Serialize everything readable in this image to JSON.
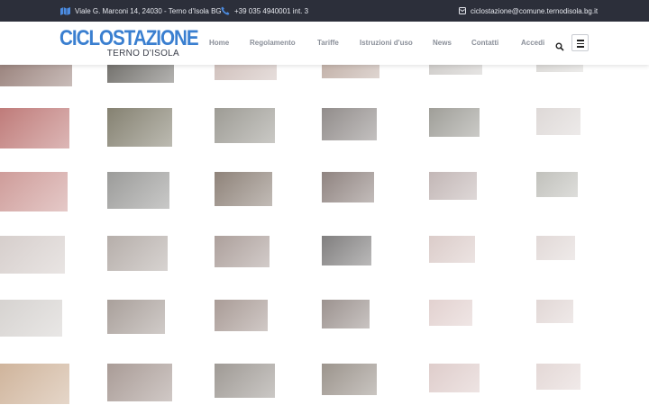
{
  "topbar": {
    "address": "Viale G. Marconi 14, 24030 - Terno d'Isola BG",
    "phone": "+39 035 4940001 int. 3",
    "email": "ciclostazione@comune.ternodisola.bg.it",
    "icons": [
      "map-icon",
      "phone-icon",
      "mail-icon"
    ]
  },
  "brand": {
    "name": "CICLOSTAZIONE",
    "subtitle": "TERNO D'ISOLA",
    "color": "#3a7fd0"
  },
  "nav": {
    "items": [
      "Home",
      "Regolamento",
      "Tariffe",
      "Istruzioni d'uso",
      "News",
      "Contatti",
      "Accedi"
    ]
  },
  "gallery": {
    "columns": 6,
    "rows": 6,
    "tile_colors": [
      [
        "#8a6f68",
        "#5c5a55",
        "#c9b7b2",
        "#b9a59b",
        "#c8c5c2",
        "#d6d4d1"
      ],
      [
        "#b46462",
        "#6f6b58",
        "#8c8a82",
        "#7e7876",
        "#8e8d86",
        "#d8d2d0"
      ],
      [
        "#c68b88",
        "#8a8a88",
        "#7b6d62",
        "#7c6e6a",
        "#b8aaa9",
        "#b6b6b0"
      ],
      [
        "#cfc6c3",
        "#a9a09b",
        "#9e8f8a",
        "#6a6868",
        "#d5c3c0",
        "#dcd2d0"
      ],
      [
        "#cfcbc8",
        "#9a8f89",
        "#9a8a84",
        "#8a7f7b",
        "#ddc9c7",
        "#dcd0ce"
      ],
      [
        "#c7a78a",
        "#9a8a84",
        "#8e8882",
        "#8a8178",
        "#d9c4c2",
        "#dfd1cf"
      ]
    ]
  }
}
